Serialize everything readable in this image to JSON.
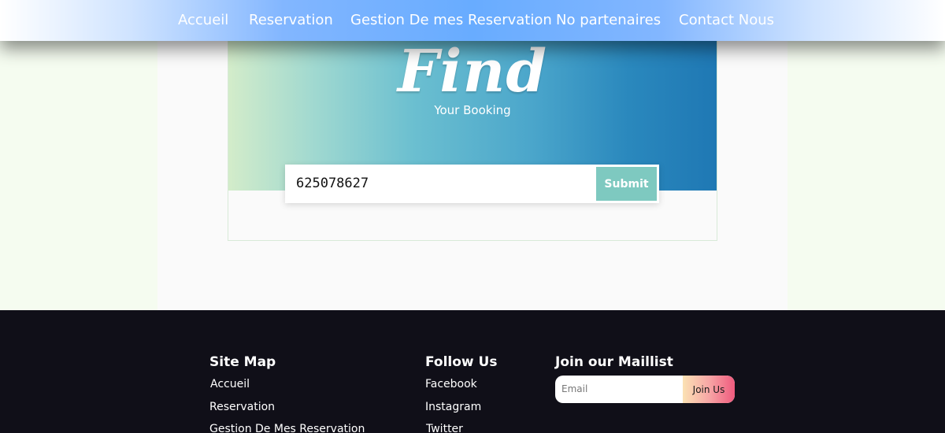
{
  "nav": {
    "items": [
      {
        "label": "Accueil"
      },
      {
        "label": "Reservation"
      },
      {
        "label": "Gestion De mes Reservation"
      },
      {
        "label": "No partenaires"
      },
      {
        "label": "Contact Nous"
      }
    ]
  },
  "hero": {
    "title": "Find",
    "subtitle": "Your Booking"
  },
  "search": {
    "value": "625078627",
    "submit_label": "Submit"
  },
  "footer": {
    "sitemap": {
      "heading": "Site Map",
      "links": [
        "Accueil",
        "Reservation",
        "Gestion De Mes Reservation"
      ]
    },
    "follow": {
      "heading": "Follow Us",
      "links": [
        "Facebook",
        "Instagram",
        "Twitter"
      ]
    },
    "maillist": {
      "heading": "Join our Maillist",
      "placeholder": "Email",
      "button_label": "Join Us"
    }
  },
  "colors": {
    "nav_accent": "#68acff",
    "submit": "#7ec9c0",
    "footer_bg": "#100f18"
  }
}
